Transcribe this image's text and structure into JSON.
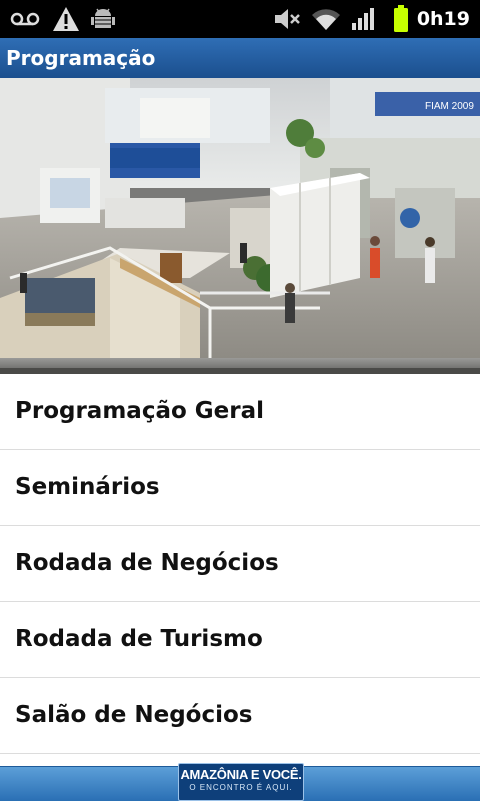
{
  "status_bar": {
    "time": "0h19",
    "icons": [
      "voicemail-icon",
      "warning-icon",
      "android-debug-icon",
      "volume-muted-icon",
      "wifi-icon",
      "signal-icon",
      "battery-icon"
    ]
  },
  "header": {
    "title": "Programação"
  },
  "banner": {
    "sign_text": "FIAM 2009"
  },
  "menu": {
    "items": [
      {
        "label": "Programação Geral"
      },
      {
        "label": "Seminários"
      },
      {
        "label": "Rodada de Negócios"
      },
      {
        "label": "Rodada de Turismo"
      },
      {
        "label": "Salão de Negócios"
      }
    ]
  },
  "footer": {
    "logo_line1": "AMAZÔNIA E VOCÊ.",
    "logo_line2": "O ENCONTRO É AQUI."
  },
  "colors": {
    "header_bg": "#2a64a8",
    "battery": "#c7ff00"
  }
}
